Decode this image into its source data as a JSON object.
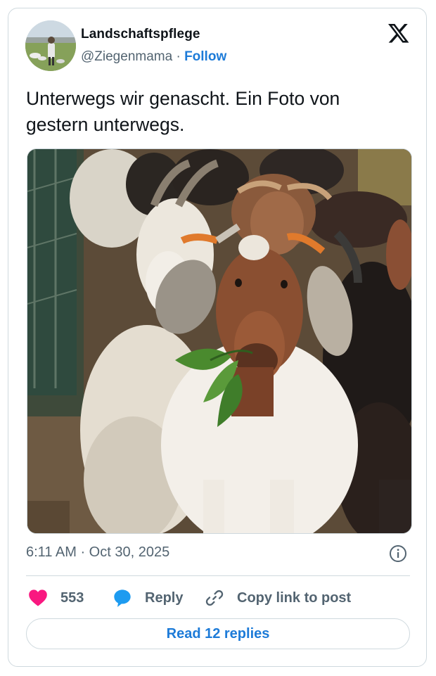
{
  "author": {
    "display_name": "Landschaftspflege",
    "handle": "@Ziegenmama",
    "separator": "·",
    "follow_label": "Follow"
  },
  "tweet": {
    "text": "Unterwegs wir genascht. Ein Foto von gestern unterwegs.",
    "timestamp": "6:11 AM · Oct 30, 2025"
  },
  "actions": {
    "like_count": "553",
    "reply_label": "Reply",
    "copy_link_label": "Copy link to post"
  },
  "footer": {
    "read_replies_label": "Read 12 replies"
  },
  "icons": {
    "logo": "x-logo-icon",
    "like": "heart-icon",
    "reply": "speech-bubble-icon",
    "copy": "link-icon",
    "info": "info-icon"
  },
  "colors": {
    "like": "#f91880",
    "reply": "#1d9bf0",
    "follow": "#1d7bd8",
    "muted": "#536471",
    "border": "#cfd9de"
  }
}
